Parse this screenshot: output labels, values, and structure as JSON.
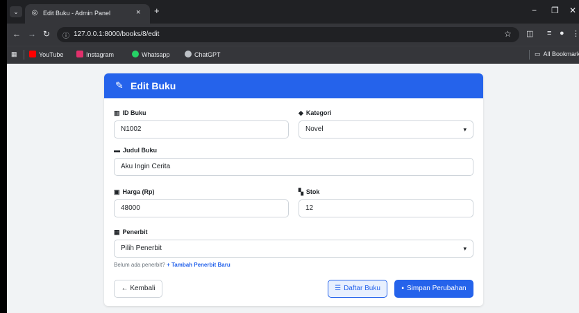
{
  "browser": {
    "tab_title": "Edit Buku - Admin Panel",
    "tab_close": "×",
    "new_tab": "+",
    "url": "127.0.0.1:8000/books/8/edit",
    "bookmarks": [
      {
        "label": "YouTube",
        "color": "#ff0000"
      },
      {
        "label": "Instagram",
        "color": "#e1306c"
      },
      {
        "label": "Whatsapp",
        "color": "#25d366"
      },
      {
        "label": "ChatGPT",
        "color": "#bdc1c6"
      }
    ],
    "all_bookmarks": "All Bookmarks"
  },
  "form": {
    "header_title": "Edit Buku",
    "fields": {
      "id_buku": {
        "label": "ID Buku",
        "value": "N1002"
      },
      "kategori": {
        "label": "Kategori",
        "value": "Novel"
      },
      "judul": {
        "label": "Judul Buku",
        "value": "Aku Ingin Cerita"
      },
      "harga": {
        "label": "Harga (Rp)",
        "value": "48000"
      },
      "stok": {
        "label": "Stok",
        "value": "12"
      },
      "penerbit": {
        "label": "Penerbit",
        "value": "Pilih Penerbit"
      }
    },
    "helper_text": "Belum ada penerbit?",
    "helper_link": "+ Tambah Penerbit Baru",
    "back_label": "← Kembali",
    "list_label": "Daftar Buku",
    "save_label": "Simpan Perubahan"
  },
  "colors": {
    "primary": "#2563eb",
    "page_bg": "#f1f3f5",
    "chrome_dark": "#202124"
  }
}
